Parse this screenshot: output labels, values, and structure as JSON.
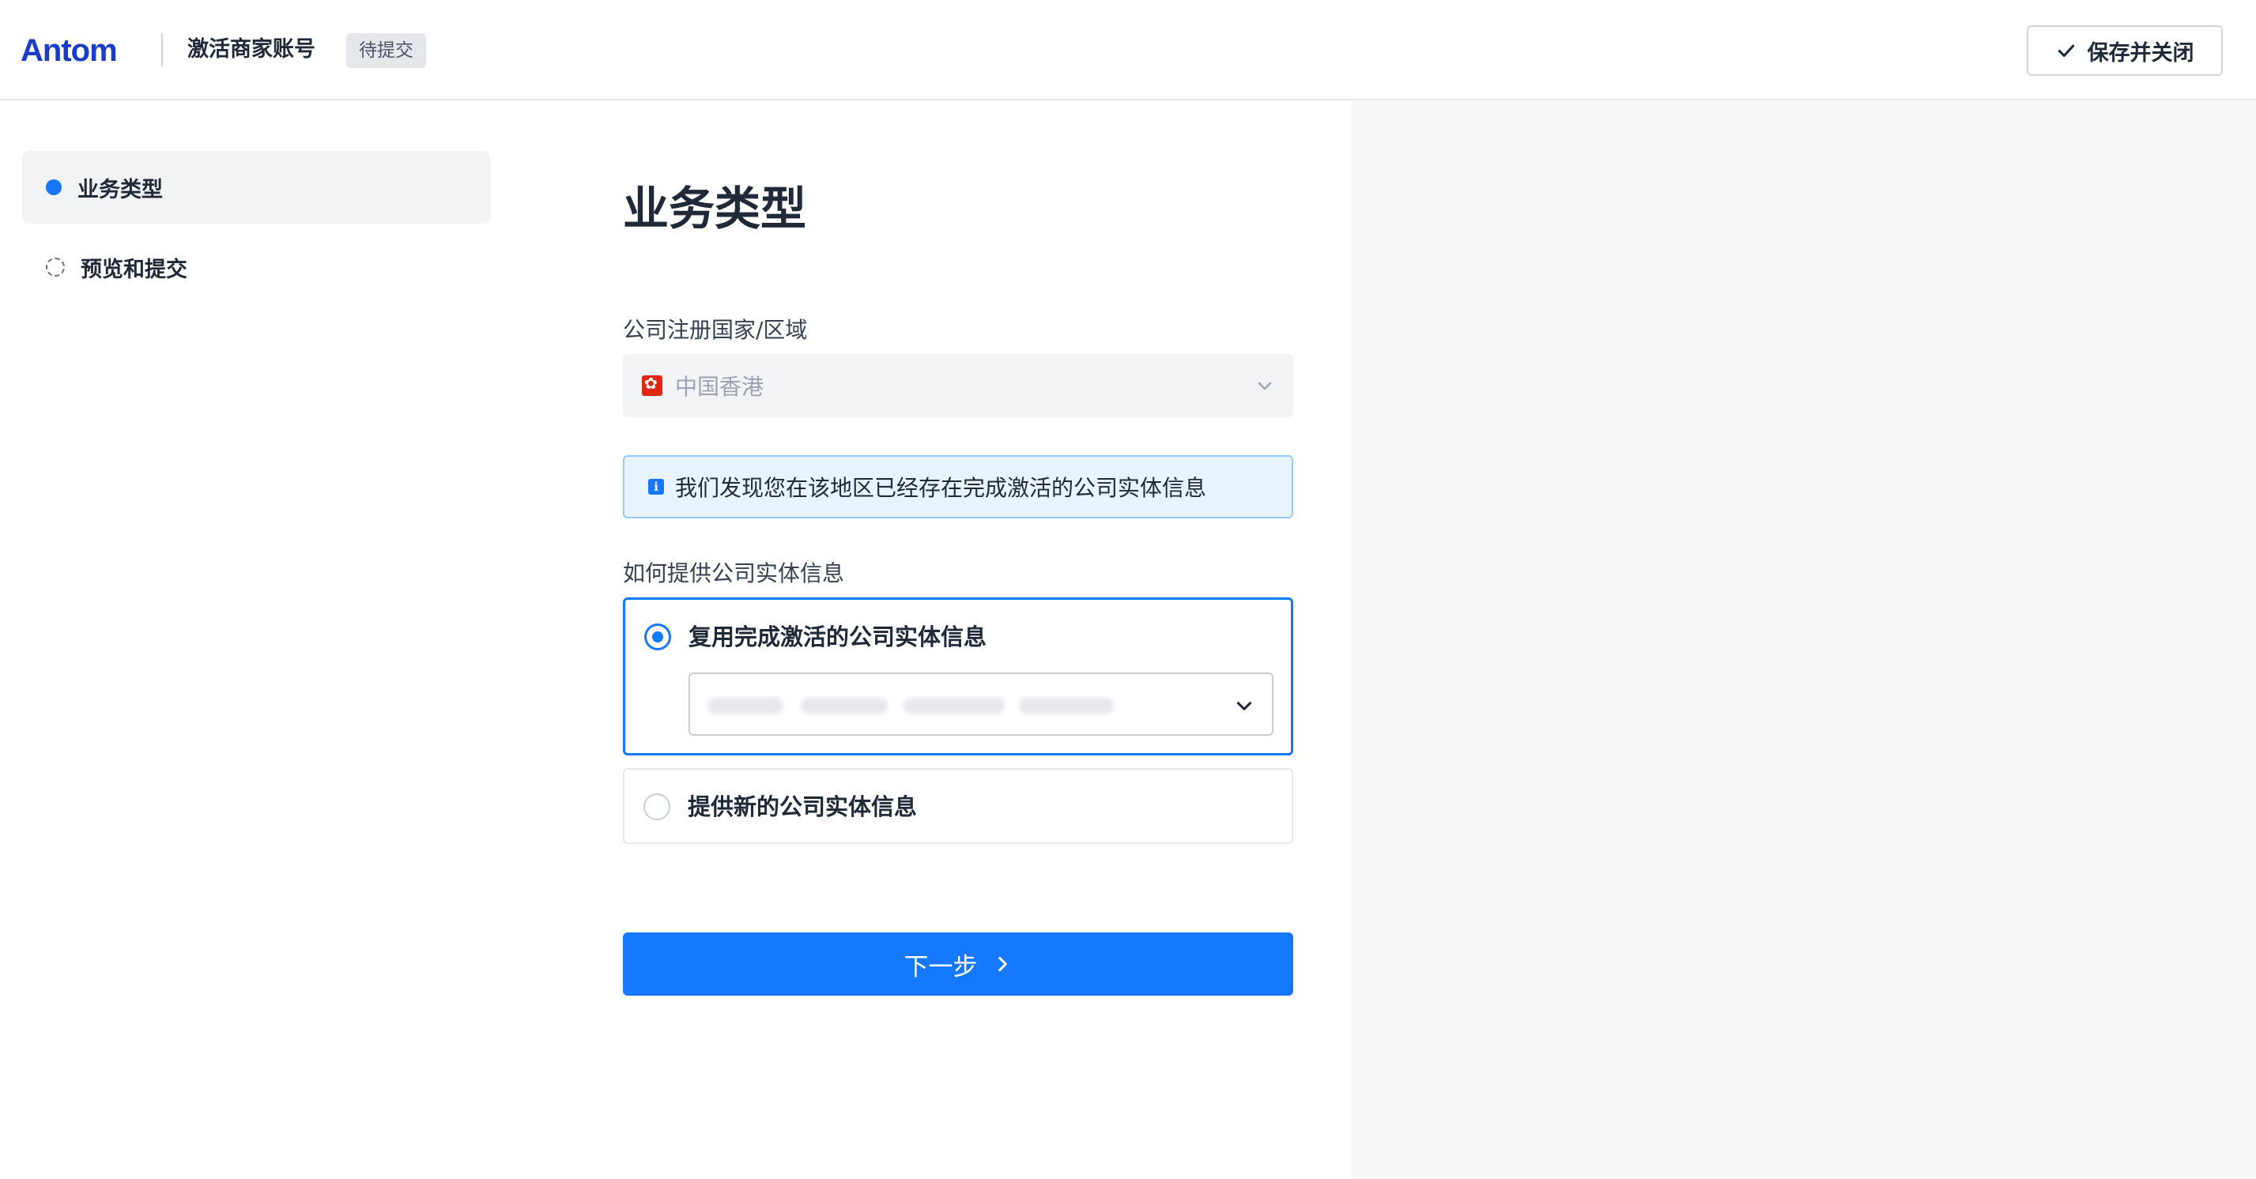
{
  "header": {
    "logo": "Antom",
    "title": "激活商家账号",
    "status_badge": "待提交",
    "save_close_label": "保存并关闭"
  },
  "sidebar": {
    "items": [
      {
        "label": "业务类型",
        "state": "active"
      },
      {
        "label": "预览和提交",
        "state": "pending"
      }
    ]
  },
  "main": {
    "page_title": "业务类型",
    "country_field": {
      "label": "公司注册国家/区域",
      "value": "中国香港",
      "flag_icon": "hong-kong-flag-icon"
    },
    "info_alert": {
      "text": "我们发现您在该地区已经存在完成激活的公司实体信息"
    },
    "entity_question": {
      "label": "如何提供公司实体信息",
      "options": [
        {
          "label": "复用完成激活的公司实体信息",
          "selected": true
        },
        {
          "label": "提供新的公司实体信息",
          "selected": false
        }
      ]
    },
    "next_button_label": "下一步"
  },
  "colors": {
    "accent": "#1677ff",
    "brand": "#1a3ccb",
    "info_bg": "#e8f3ff",
    "right_panel_bg": "#f7f8fa"
  }
}
